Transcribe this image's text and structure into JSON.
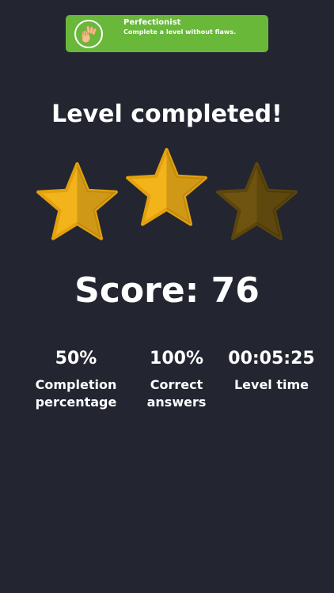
{
  "achievement": {
    "title": "Perfectionist",
    "description": "Complete a level without flaws.",
    "icon": "ok-hand-icon",
    "color": "#69b83a"
  },
  "result": {
    "title": "Level completed!",
    "stars_earned": 2,
    "stars_total": 3,
    "score": "Score: 76"
  },
  "stats": [
    {
      "value": "50%",
      "label": "Completion percentage"
    },
    {
      "value": "100%",
      "label": "Correct answers"
    },
    {
      "value": "00:05:25",
      "label": "Level time"
    }
  ],
  "colors": {
    "background": "#232631",
    "star_filled": "#f2b31b",
    "star_empty": "#6e5410",
    "text": "#ffffff"
  }
}
